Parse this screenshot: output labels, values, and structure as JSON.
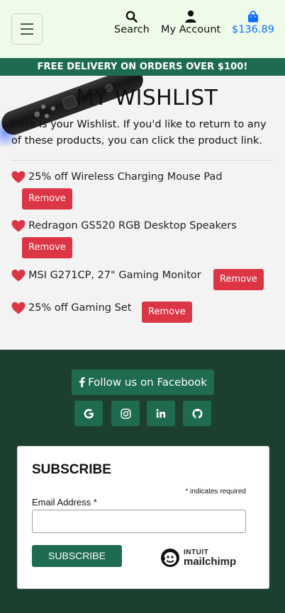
{
  "header": {
    "search_label": "Search",
    "account_label": "My Account",
    "bag_total": "$136.89"
  },
  "banner": {
    "text": "FREE DELIVERY ON ORDERS OVER $100!"
  },
  "wishlist": {
    "title": "MY WISHLIST",
    "intro": "Here is your Wishlist. If you'd like to return to any of these products, you can click the product link.",
    "remove_label": "Remove",
    "items": [
      {
        "name": "25% off Wireless Charging Mouse Pad"
      },
      {
        "name": "Redragon GS520 RGB Desktop Speakers"
      },
      {
        "name": "MSI G271CP, 27\" Gaming Monitor"
      },
      {
        "name": "25% off Gaming Set"
      }
    ]
  },
  "footer": {
    "facebook_label": "Follow us on Facebook",
    "social_icons": [
      "google-icon",
      "instagram-icon",
      "linkedin-icon",
      "github-icon"
    ],
    "subscribe": {
      "heading": "SUBSCRIBE",
      "required_note": "* indicates required",
      "email_label": "Email Address *",
      "email_value": "",
      "button_label": "SUBSCRIBE",
      "brand_top": "INTUIT",
      "brand_bottom": "mailchimp"
    }
  },
  "colors": {
    "brand_green": "#1e6b4f",
    "footer_bg": "#1d3f30",
    "topbar_bg": "#effbe9",
    "remove_red": "#dc3545",
    "heart_red": "#dc3545",
    "bag_blue": "#0d6efd"
  }
}
